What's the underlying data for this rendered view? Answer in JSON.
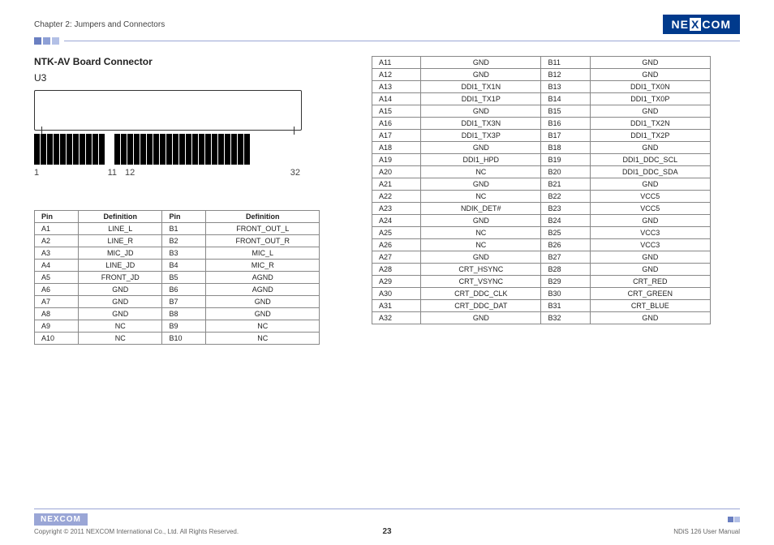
{
  "header": {
    "chapter": "Chapter 2: Jumpers and Connectors",
    "brand": "NEXCOM"
  },
  "section": {
    "title": "NTK-AV Board Connector",
    "designator": "U3"
  },
  "diagram_labels": {
    "l1": "1",
    "l11": "11",
    "l12": "12",
    "l32": "32"
  },
  "left_table": {
    "headers": [
      "Pin",
      "Definition",
      "Pin",
      "Definition"
    ],
    "rows": [
      [
        "A1",
        "LINE_L",
        "B1",
        "FRONT_OUT_L"
      ],
      [
        "A2",
        "LINE_R",
        "B2",
        "FRONT_OUT_R"
      ],
      [
        "A3",
        "MIC_JD",
        "B3",
        "MIC_L"
      ],
      [
        "A4",
        "LINE_JD",
        "B4",
        "MIC_R"
      ],
      [
        "A5",
        "FRONT_JD",
        "B5",
        "AGND"
      ],
      [
        "A6",
        "GND",
        "B6",
        "AGND"
      ],
      [
        "A7",
        "GND",
        "B7",
        "GND"
      ],
      [
        "A8",
        "GND",
        "B8",
        "GND"
      ],
      [
        "A9",
        "NC",
        "B9",
        "NC"
      ],
      [
        "A10",
        "NC",
        "B10",
        "NC"
      ]
    ]
  },
  "right_table": {
    "rows": [
      [
        "A11",
        "GND",
        "B11",
        "GND"
      ],
      [
        "A12",
        "GND",
        "B12",
        "GND"
      ],
      [
        "A13",
        "DDI1_TX1N",
        "B13",
        "DDI1_TX0N"
      ],
      [
        "A14",
        "DDI1_TX1P",
        "B14",
        "DDI1_TX0P"
      ],
      [
        "A15",
        "GND",
        "B15",
        "GND"
      ],
      [
        "A16",
        "DDI1_TX3N",
        "B16",
        "DDI1_TX2N"
      ],
      [
        "A17",
        "DDI1_TX3P",
        "B17",
        "DDI1_TX2P"
      ],
      [
        "A18",
        "GND",
        "B18",
        "GND"
      ],
      [
        "A19",
        "DDI1_HPD",
        "B19",
        "DDI1_DDC_SCL"
      ],
      [
        "A20",
        "NC",
        "B20",
        "DDI1_DDC_SDA"
      ],
      [
        "A21",
        "GND",
        "B21",
        "GND"
      ],
      [
        "A22",
        "NC",
        "B22",
        "VCC5"
      ],
      [
        "A23",
        "NDIK_DET#",
        "B23",
        "VCC5"
      ],
      [
        "A24",
        "GND",
        "B24",
        "GND"
      ],
      [
        "A25",
        "NC",
        "B25",
        "VCC3"
      ],
      [
        "A26",
        "NC",
        "B26",
        "VCC3"
      ],
      [
        "A27",
        "GND",
        "B27",
        "GND"
      ],
      [
        "A28",
        "CRT_HSYNC",
        "B28",
        "GND"
      ],
      [
        "A29",
        "CRT_VSYNC",
        "B29",
        "CRT_RED"
      ],
      [
        "A30",
        "CRT_DDC_CLK",
        "B30",
        "CRT_GREEN"
      ],
      [
        "A31",
        "CRT_DDC_DAT",
        "B31",
        "CRT_BLUE"
      ],
      [
        "A32",
        "GND",
        "B32",
        "GND"
      ]
    ]
  },
  "footer": {
    "copyright": "Copyright © 2011 NEXCOM International Co., Ltd. All Rights Reserved.",
    "page": "23",
    "manual": "NDiS 126 User Manual",
    "brand_small": "NEXCOM"
  }
}
